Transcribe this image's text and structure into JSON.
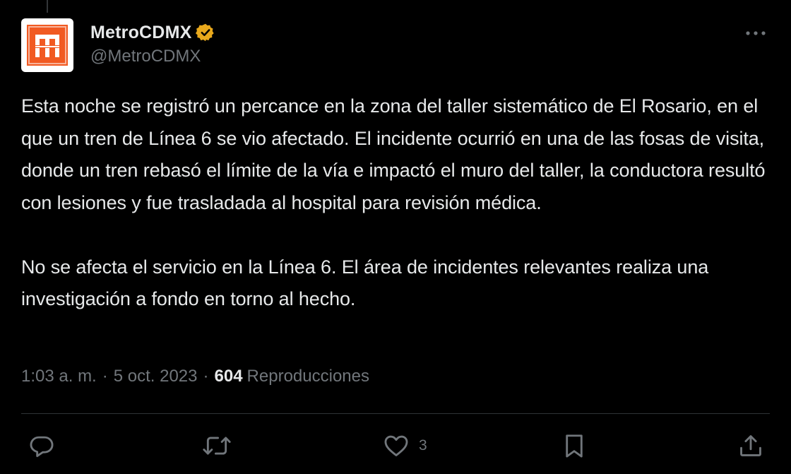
{
  "tweet": {
    "display_name": "MetroCDMX",
    "handle": "@MetroCDMX",
    "verified": true,
    "text": "Esta noche se registró un percance en la zona del taller sistemático de El Rosario, en el que un tren de Línea 6 se vio afectado. El incidente ocurrió en una de las fosas de visita, donde un tren rebasó el límite de la vía e impactó el muro del taller, la conductora resultó con lesiones y fue trasladada al hospital para revisión médica.\n\nNo se afecta el servicio en la Línea 6. El área de incidentes relevantes realiza una investigación a fondo en torno al hecho.",
    "time": "1:03 a. m.",
    "date": "5 oct. 2023",
    "separator": "·",
    "views_count": "604",
    "views_label": "Reproducciones"
  },
  "actions": {
    "reply_icon": "reply-icon",
    "retweet_icon": "retweet-icon",
    "like_icon": "like-icon",
    "like_count": "3",
    "bookmark_icon": "bookmark-icon",
    "share_icon": "share-icon",
    "more_icon": "more-dots-icon"
  },
  "colors": {
    "background": "#000000",
    "text_primary": "#e7e9ea",
    "text_secondary": "#71767b",
    "divider": "#2f3336",
    "metro_orange": "#f15a22",
    "verified_gold": "#e8a81c"
  }
}
